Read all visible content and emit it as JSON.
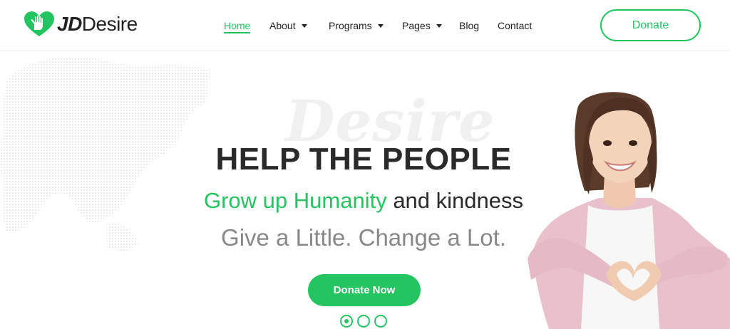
{
  "brand": {
    "name_part1": "JD",
    "name_part2": "Desire",
    "logo_icon": "heart-hand-icon",
    "accent_color": "#24c560"
  },
  "nav": {
    "items": [
      {
        "label": "Home",
        "active": true
      },
      {
        "label": "About",
        "has_dropdown": true
      },
      {
        "label": "Programs",
        "has_dropdown": true
      },
      {
        "label": "Pages",
        "has_dropdown": true
      },
      {
        "label": "Blog"
      },
      {
        "label": "Contact"
      }
    ],
    "donate_label": "Donate"
  },
  "hero": {
    "watermark": "Desire",
    "title": "HELP THE PEOPLE",
    "subtitle_green": "Grow up Humanity",
    "subtitle_rest": " and kindness",
    "tagline": "Give a Little. Change a Lot.",
    "cta_label": "Donate Now",
    "slides": {
      "count": 3,
      "active": 1
    }
  }
}
